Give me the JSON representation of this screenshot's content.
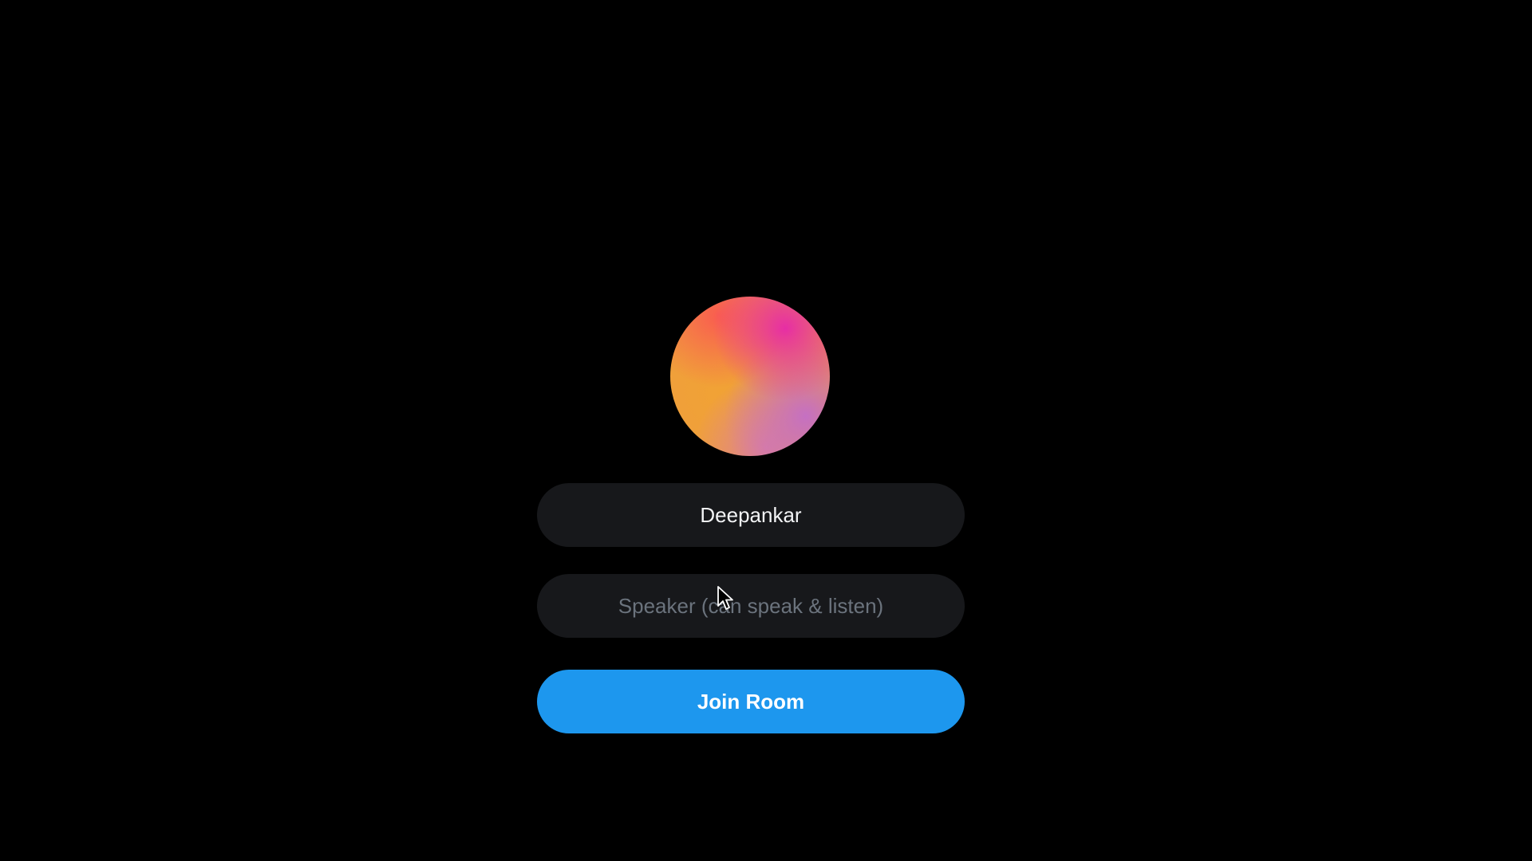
{
  "profile": {
    "avatar_colors": [
      "#f1a235",
      "#e628aa",
      "#fa5a50",
      "#c36ec8"
    ]
  },
  "form": {
    "name_value": "Deepankar",
    "role_placeholder": "Speaker (can speak & listen)",
    "join_label": "Join Room"
  },
  "colors": {
    "background": "#000000",
    "field_background": "#17181b",
    "accent": "#1d97ee",
    "placeholder_text": "#6b737d"
  },
  "icons": {
    "pointer": "mouse-cursor-icon"
  }
}
